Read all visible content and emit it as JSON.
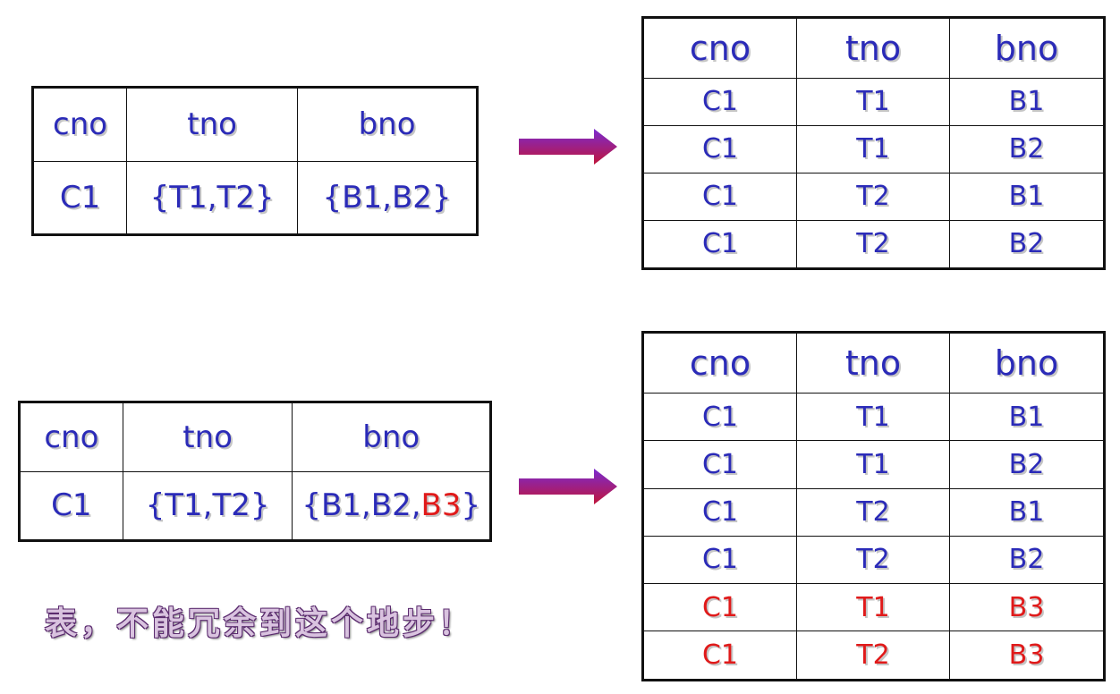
{
  "headers": {
    "cno": "cno",
    "tno": "tno",
    "bno": "bno"
  },
  "table1": {
    "row": {
      "cno": "C1",
      "tno": "{T1,T2}",
      "bno": "{B1,B2}"
    }
  },
  "table2": {
    "rows": [
      {
        "cno": "C1",
        "tno": "T1",
        "bno": "B1"
      },
      {
        "cno": "C1",
        "tno": "T1",
        "bno": "B2"
      },
      {
        "cno": "C1",
        "tno": "T2",
        "bno": "B1"
      },
      {
        "cno": "C1",
        "tno": "T2",
        "bno": "B2"
      }
    ]
  },
  "table3": {
    "row": {
      "cno": "C1",
      "tno": "{T1,T2}",
      "bno_prefix": "{B1,B2,",
      "bno_highlight": "B3",
      "bno_suffix": "}"
    }
  },
  "table4": {
    "rows": [
      {
        "cno": "C1",
        "tno": "T1",
        "bno": "B1"
      },
      {
        "cno": "C1",
        "tno": "T1",
        "bno": "B2"
      },
      {
        "cno": "C1",
        "tno": "T2",
        "bno": "B1"
      },
      {
        "cno": "C1",
        "tno": "T2",
        "bno": "B2"
      },
      {
        "cno": "C1",
        "tno": "T1",
        "bno": "B3"
      },
      {
        "cno": "C1",
        "tno": "T2",
        "bno": "B3"
      }
    ]
  },
  "note": "表，不能冗余到这个地步！",
  "colors": {
    "text": "#2b2bb8",
    "highlight": "#e01a1a",
    "arrow_start": "#7a2ad0",
    "arrow_end": "#c0163a"
  }
}
